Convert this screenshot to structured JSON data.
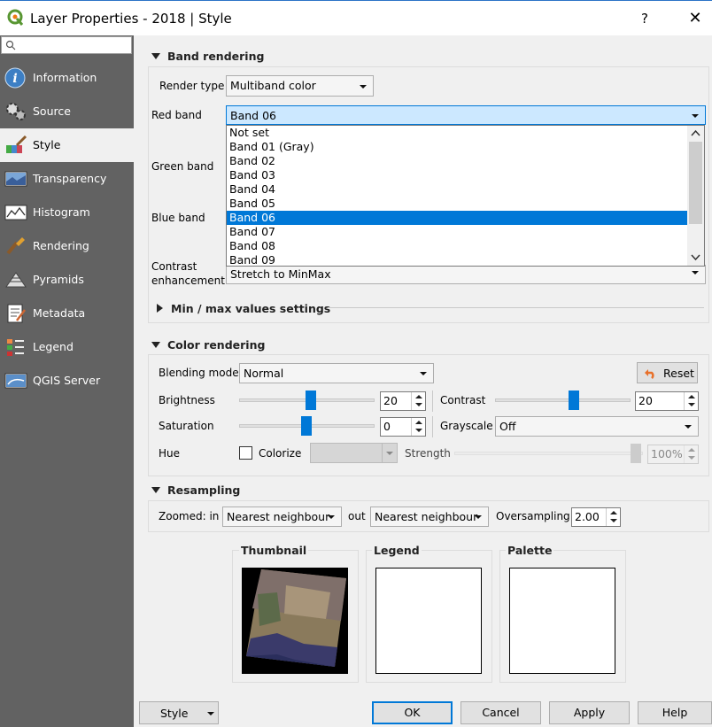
{
  "window": {
    "title": "Layer Properties - 2018 | Style",
    "help_label": "?",
    "close_label": "✕"
  },
  "sidebar": {
    "search_placeholder": "",
    "items": [
      {
        "label": "Information",
        "icon": "information-icon"
      },
      {
        "label": "Source",
        "icon": "source-icon"
      },
      {
        "label": "Style",
        "icon": "style-brush-icon",
        "active": true
      },
      {
        "label": "Transparency",
        "icon": "transparency-icon"
      },
      {
        "label": "Histogram",
        "icon": "histogram-icon"
      },
      {
        "label": "Rendering",
        "icon": "rendering-icon"
      },
      {
        "label": "Pyramids",
        "icon": "pyramids-icon"
      },
      {
        "label": "Metadata",
        "icon": "metadata-icon"
      },
      {
        "label": "Legend",
        "icon": "legend-icon"
      },
      {
        "label": "QGIS Server",
        "icon": "qgis-server-icon"
      }
    ]
  },
  "band_rendering": {
    "title": "Band rendering",
    "render_type_label": "Render type",
    "render_type_value": "Multiband color",
    "red_band_label": "Red band",
    "red_band_value": "Band 06",
    "green_band_label": "Green band",
    "blue_band_label": "Blue band",
    "contrast_label_1": "Contrast",
    "contrast_label_2": "enhancement",
    "contrast_value": "Stretch to MinMax",
    "minmax_title": "Min / max values settings",
    "band_options": [
      "Not set",
      "Band 01 (Gray)",
      "Band 02",
      "Band 03",
      "Band 04",
      "Band 05",
      "Band 06",
      "Band 07",
      "Band 08",
      "Band 09"
    ],
    "selected_option": "Band 06"
  },
  "color_rendering": {
    "title": "Color rendering",
    "blending_label": "Blending mode",
    "blending_value": "Normal",
    "reset_label": "Reset",
    "brightness_label": "Brightness",
    "brightness_value": "20",
    "contrast_label": "Contrast",
    "contrast_value": "20",
    "saturation_label": "Saturation",
    "saturation_value": "0",
    "grayscale_label": "Grayscale",
    "grayscale_value": "Off",
    "hue_label": "Hue",
    "colorize_label": "Colorize",
    "strength_label": "Strength",
    "strength_value": "100%"
  },
  "resampling": {
    "title": "Resampling",
    "zoomed_label": "Zoomed: in",
    "zoomed_in_value": "Nearest neighbour",
    "out_label": "out",
    "zoomed_out_value": "Nearest neighbour",
    "oversampling_label": "Oversampling",
    "oversampling_value": "2.00"
  },
  "previews": {
    "thumbnail_label": "Thumbnail",
    "legend_label": "Legend",
    "palette_label": "Palette"
  },
  "buttons": {
    "style_label": "Style",
    "ok_label": "OK",
    "cancel_label": "Cancel",
    "apply_label": "Apply",
    "help_label": "Help"
  },
  "colors": {
    "accent": "#0078d7",
    "sidebar_bg": "#626262",
    "dropdown_highlight": "#cce8ff"
  }
}
